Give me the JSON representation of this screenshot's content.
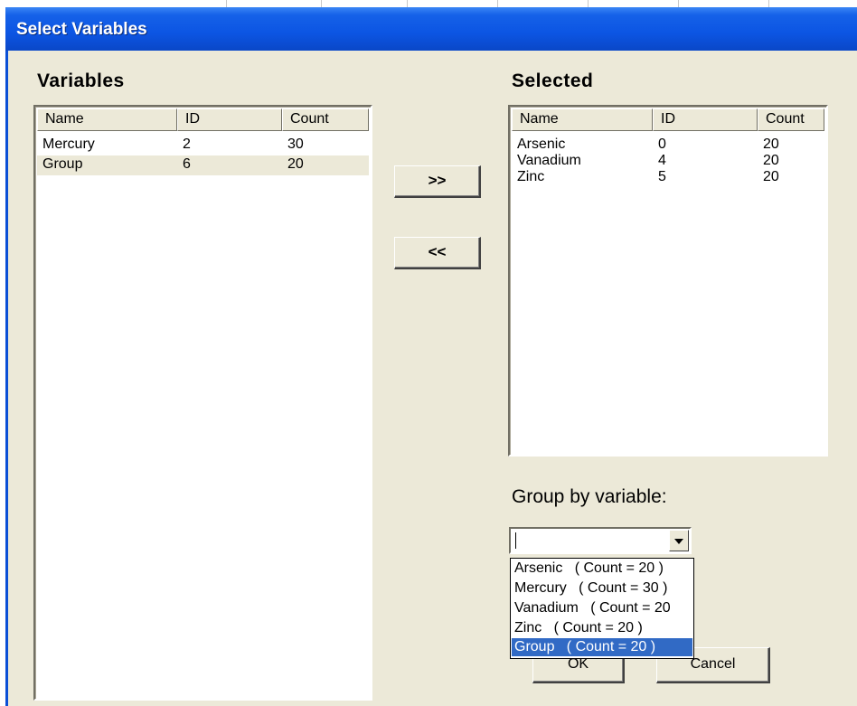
{
  "window": {
    "title": "Select Variables"
  },
  "variables": {
    "title": "Variables",
    "columns": [
      "Name",
      "ID",
      "Count"
    ],
    "rows": [
      {
        "name": "Mercury",
        "id": "2",
        "count": "30"
      },
      {
        "name": "Group",
        "id": "6",
        "count": "20"
      }
    ]
  },
  "buttons": {
    "add": ">>",
    "remove": "<<",
    "ok": "OK",
    "cancel": "Cancel"
  },
  "selected": {
    "title": "Selected",
    "columns": [
      "Name",
      "ID",
      "Count"
    ],
    "rows": [
      {
        "name": "Arsenic",
        "id": "0",
        "count": "20"
      },
      {
        "name": "Vanadium",
        "id": "4",
        "count": "20"
      },
      {
        "name": "Zinc",
        "id": "5",
        "count": "20"
      }
    ]
  },
  "group_by": {
    "label": "Group by variable:",
    "value": "",
    "options": [
      "Arsenic   ( Count = 20 )",
      "Mercury   ( Count = 30 )",
      "Vanadium   ( Count = 20",
      "Zinc   ( Count = 20 )",
      "Group   ( Count = 20 )"
    ],
    "highlighted_index": 4
  },
  "colors": {
    "titlebar": "#0c55e3",
    "face": "#ece9d8",
    "selection": "#316ac5"
  }
}
